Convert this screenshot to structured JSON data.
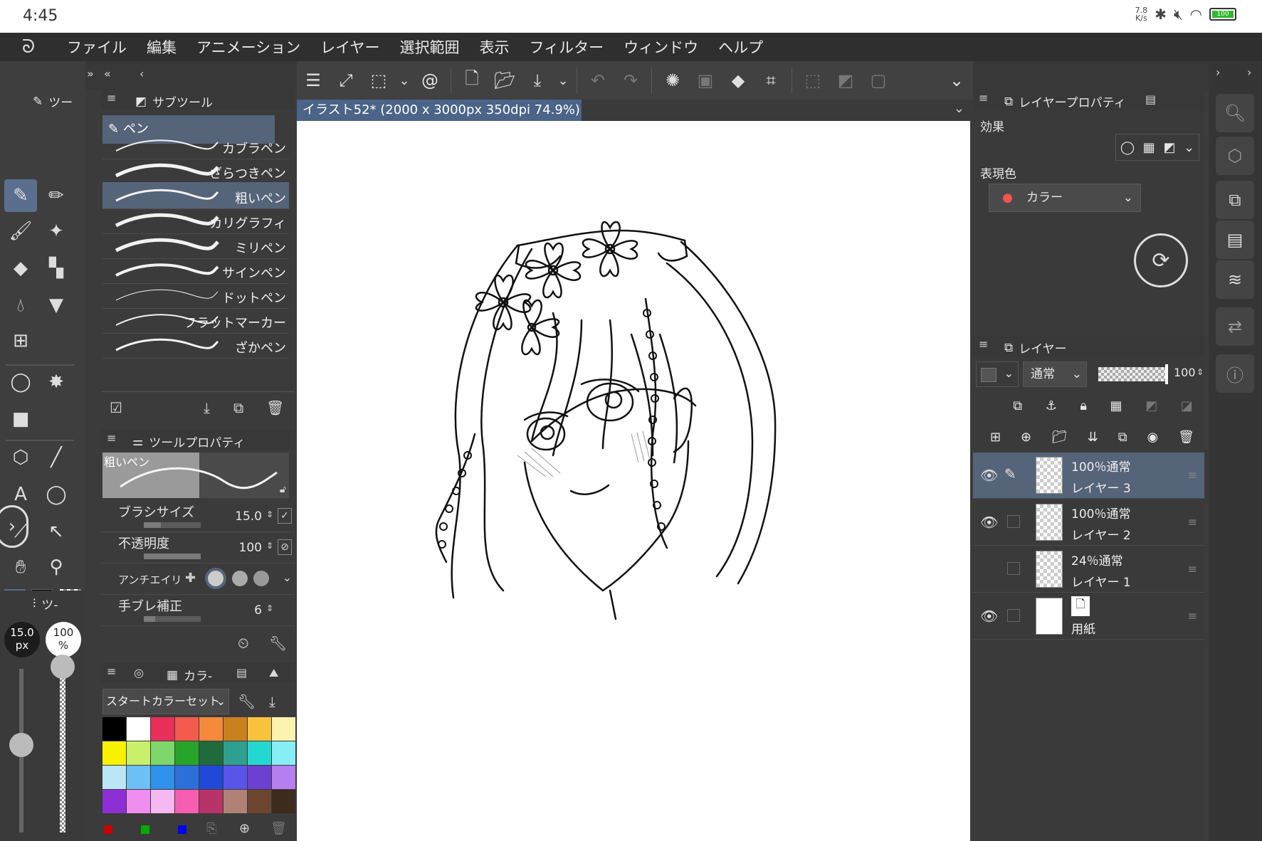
{
  "status_bar": {
    "time": "4:45",
    "net_speed": "7.8\nK/s",
    "battery": "100"
  },
  "menu": [
    "ファイル",
    "編集",
    "アニメーション",
    "レイヤー",
    "選択範囲",
    "表示",
    "フィルター",
    "ウィンドウ",
    "ヘルプ"
  ],
  "document": {
    "title": "イラスト52* (2000 x 3000px 350dpi 74.9%)"
  },
  "tool_panel": {
    "tab_label": "ツー"
  },
  "subtool": {
    "tab_label": "サブツール",
    "group_label": "ペン",
    "brushes": [
      {
        "label": "カブラペン",
        "selected": false
      },
      {
        "label": "ざらつきペン",
        "selected": false
      },
      {
        "label": "粗いペン",
        "selected": true
      },
      {
        "label": "カリグラフィ",
        "selected": false
      },
      {
        "label": "ミリペン",
        "selected": false
      },
      {
        "label": "サインペン",
        "selected": false
      },
      {
        "label": "ドットペン",
        "selected": false
      },
      {
        "label": "フラットマーカー",
        "selected": false
      },
      {
        "label": "ざかペン",
        "selected": false
      }
    ]
  },
  "tool_property": {
    "tab_label": "ツールプロパティ",
    "preview_label": "粗いペン",
    "brush_size_label": "ブラシサイズ",
    "brush_size_value": "15.0",
    "opacity_label": "不透明度",
    "opacity_value": "100",
    "antialias_label": "アンチエイリ",
    "stabilization_label": "手ブレ補正",
    "stabilization_value": "6"
  },
  "mini_indicator": {
    "size": "15.0",
    "size_unit": "px",
    "opacity": "100",
    "opacity_unit": "%"
  },
  "color_panel": {
    "tab_label": "カラ-",
    "set_name": "スタートカラーセット",
    "swatches": [
      "#000000",
      "#ffffff",
      "#e8305a",
      "#f55a4e",
      "#f58a3c",
      "#c9801f",
      "#f9c23c",
      "#fdf3b0",
      "#f8f100",
      "#c9f06a",
      "#7fd66a",
      "#27a52b",
      "#1f6b3c",
      "#2fa08f",
      "#23d8d0",
      "#85eff3",
      "#bce6f6",
      "#6cc0f5",
      "#2f92ea",
      "#2d6fd9",
      "#1f49d6",
      "#5a54e8",
      "#6b3fcf",
      "#b57fef",
      "#8b2fd4",
      "#f08ef0",
      "#f5b8f0",
      "#f65db1",
      "#b83367",
      "#b08276",
      "#6b4530",
      "#3c2b1e"
    ],
    "bottom_swatches": [
      "#cc0000",
      "#00aa00",
      "#0000ee"
    ]
  },
  "layer_property": {
    "tab_label": "レイヤープロパティ",
    "effect_label": "効果",
    "expression_label": "表現色",
    "expression_value": "カラー"
  },
  "layers_panel": {
    "tab_label": "レイヤー",
    "blend_mode": "通常",
    "opacity": "100",
    "layers": [
      {
        "line1": "100％通常",
        "line2": "レイヤー 3",
        "visible": true,
        "selected": true,
        "thumb": "transparent"
      },
      {
        "line1": "100％通常",
        "line2": "レイヤー 2",
        "visible": true,
        "selected": false,
        "thumb": "transparent"
      },
      {
        "line1": "24％通常",
        "line2": "レイヤー 1",
        "visible": false,
        "selected": false,
        "thumb": "sketch"
      },
      {
        "line1": "",
        "line2": "用紙",
        "visible": true,
        "selected": false,
        "thumb": "paper"
      }
    ]
  }
}
